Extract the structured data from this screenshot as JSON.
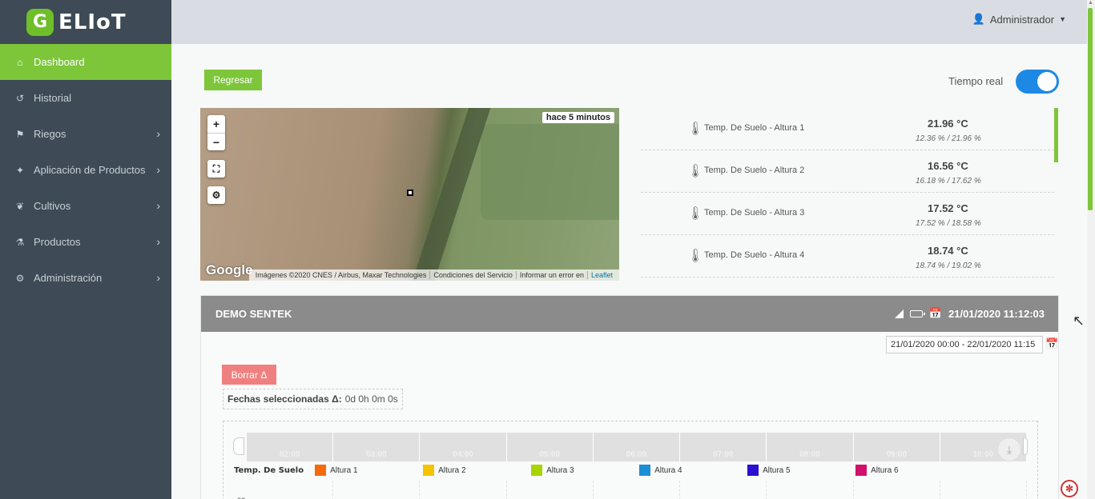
{
  "brand": {
    "logo_letter": "G",
    "name": "ELIoT",
    "logo_color": "#6fbf2a"
  },
  "sidebar": {
    "items": [
      {
        "label": "Dashboard",
        "icon": "home-icon",
        "active": true,
        "chevron": false
      },
      {
        "label": "Historial",
        "icon": "history-icon",
        "active": false,
        "chevron": false
      },
      {
        "label": "Riegos",
        "icon": "irrigation-icon",
        "active": false,
        "chevron": true
      },
      {
        "label": "Aplicación de Productos",
        "icon": "spray-icon",
        "active": false,
        "chevron": true
      },
      {
        "label": "Cultivos",
        "icon": "leaf-icon",
        "active": false,
        "chevron": true
      },
      {
        "label": "Productos",
        "icon": "flask-icon",
        "active": false,
        "chevron": true
      },
      {
        "label": "Administración",
        "icon": "gear-icon",
        "active": false,
        "chevron": true
      }
    ]
  },
  "header": {
    "user_label": "Administrador"
  },
  "toolbar": {
    "back_label": "Regresar",
    "realtime_label": "Tiempo real",
    "realtime_on": true
  },
  "map": {
    "zoom_in": "+",
    "zoom_out": "−",
    "last_update": "hace 5 minutos",
    "google": "Google",
    "attribution": "Imágenes ©2020 CNES / Airbus, Maxar Technologies",
    "terms": "Condiciones del Servicio",
    "report": "Informar un error en",
    "leaflet": "Leaflet"
  },
  "sensors": [
    {
      "name": "Temp. De Suelo - Altura 1",
      "value": "21.96 °C",
      "range": "12.36 % / 21.96 %"
    },
    {
      "name": "Temp. De Suelo - Altura 2",
      "value": "16.56 °C",
      "range": "16.18 % / 17.62 %"
    },
    {
      "name": "Temp. De Suelo - Altura 3",
      "value": "17.52 °C",
      "range": "17.52 % / 18.58 %"
    },
    {
      "name": "Temp. De Suelo - Altura 4",
      "value": "18.74 °C",
      "range": "18.74 % / 19.02 %"
    }
  ],
  "device": {
    "name": "DEMO SENTEK",
    "timestamp": "21/01/2020 11:12:03",
    "date_range": "21/01/2020 00:00 - 22/01/2020 11:15",
    "clear_label": "Borrar Δ",
    "selected_label": "Fechas seleccionadas Δ:",
    "selected_value": "0d 0h 0m 0s"
  },
  "chart": {
    "times": [
      "02:00",
      "03:00",
      "04:00",
      "05:00",
      "06:00",
      "07:00",
      "08:00",
      "09:00",
      "10:00"
    ],
    "legend_title": "Temp. De Suelo",
    "series": [
      {
        "name": "Altura 1",
        "color": "#f46a0a"
      },
      {
        "name": "Altura 2",
        "color": "#f5c400"
      },
      {
        "name": "Altura 3",
        "color": "#a8d400"
      },
      {
        "name": "Altura 4",
        "color": "#1a8fd6"
      },
      {
        "name": "Altura 5",
        "color": "#2a10d0"
      },
      {
        "name": "Altura 6",
        "color": "#d0106a"
      }
    ],
    "y_tick": "22"
  }
}
